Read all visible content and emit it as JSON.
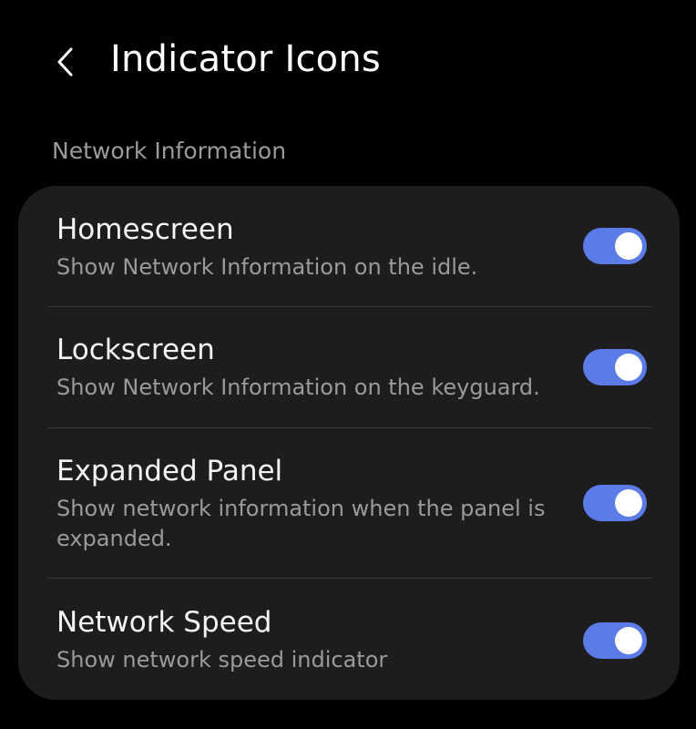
{
  "header": {
    "title": "Indicator Icons",
    "back_icon": "chevron-left-icon"
  },
  "section": {
    "label": "Network Information"
  },
  "settings": [
    {
      "title": "Homescreen",
      "description": "Show Network Information on the idle.",
      "enabled": true
    },
    {
      "title": "Lockscreen",
      "description": "Show Network Information on the keyguard.",
      "enabled": true
    },
    {
      "title": "Expanded Panel",
      "description": "Show network information when the panel is expanded.",
      "enabled": true
    },
    {
      "title": "Network Speed",
      "description": "Show network speed indicator",
      "enabled": true
    }
  ],
  "colors": {
    "background": "#000000",
    "card": "#1d1d1f",
    "toggle_on": "#5b7be6",
    "secondary_text": "#9a9a9a"
  }
}
